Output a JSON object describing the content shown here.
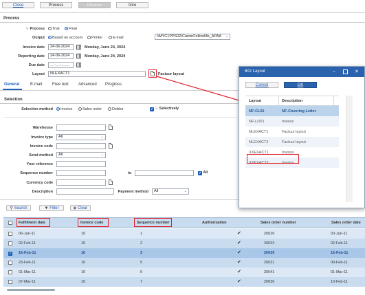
{
  "toolbar": {
    "close": "Close",
    "process": "Process",
    "preview": "Preview",
    "giro": "Giro"
  },
  "process_section": {
    "title": "Process",
    "process_label": "Process",
    "process_options": [
      "Trial",
      "Final"
    ],
    "output_label": "Output",
    "output_options": [
      "Based on account",
      "Printer",
      "E-mail"
    ],
    "printer_value": "\\\\MYC1PPS02\\CanonFollowMe_APAA",
    "invoice_date_label": "Invoice date",
    "invoice_date": "24-06-2024",
    "invoice_date_text": "Monday, June 24, 2024",
    "reporting_date_label": "Reporting date",
    "reporting_date": "24-06-2024",
    "reporting_date_text": "Monday, June 24, 2024",
    "due_date_label": "Due date",
    "due_date": "__-__-____",
    "layout_label": "Layout",
    "layout_value": "NLEXACT1",
    "layout_text": "Factuur layout"
  },
  "tabs": [
    "General",
    "E-mail",
    "Free text",
    "Advanced",
    "Progress"
  ],
  "selection": {
    "title": "Selection",
    "method_label": "Selection method",
    "methods": [
      "Invoice",
      "Sales order",
      "Debtor"
    ],
    "selectively_label": "Selectively",
    "warehouse_label": "Warehouse",
    "invoice_type_label": "Invoice type",
    "invoice_type_value": "All",
    "invoice_code_label": "Invoice code",
    "send_method_label": "Send method",
    "send_method_value": "All",
    "your_reference_label": "Your reference",
    "sequence_number_label": "Sequence number",
    "to_label": "to",
    "all_label": "All",
    "currency_code_label": "Currency code",
    "description_label": "Description",
    "payment_method_label": "Payment method",
    "payment_method_value": "All"
  },
  "filter_bar": {
    "search": "Search",
    "filter": "Filter",
    "clear": "Clear"
  },
  "grid": {
    "headers": [
      "Fulfilment date",
      "Invoice code",
      "Sequence number",
      "Authorization",
      "Sales order number",
      "Sales order date"
    ],
    "rows": [
      {
        "date": "06-Jan-11",
        "code": "10",
        "seq": "1",
        "so": "20026",
        "sodate": "03-Jan-11"
      },
      {
        "date": "02-Feb-11",
        "code": "10",
        "seq": "2",
        "so": "20033",
        "sodate": "02-Feb-11"
      },
      {
        "date": "16-Feb-11",
        "code": "10",
        "seq": "3",
        "so": "20039",
        "sodate": "15-Feb-11"
      },
      {
        "date": "23-Feb-11",
        "code": "10",
        "seq": "5",
        "so": "20031",
        "sodate": "09-Feb-11"
      },
      {
        "date": "01-Mar-11",
        "code": "10",
        "seq": "6",
        "so": "20041",
        "sodate": "01-Mar-11"
      },
      {
        "date": "07-Mar-11",
        "code": "10",
        "seq": "7",
        "so": "20036",
        "sodate": "10-Feb-11"
      }
    ]
  },
  "dialog": {
    "title": "602 Layout",
    "cancel": "Cancel",
    "ok": "OK",
    "headers": [
      "Layout",
      "Description"
    ],
    "rows": [
      {
        "layout": "NF-CL01",
        "desc": "NF-Covering Letter"
      },
      {
        "layout": "NF-LO01",
        "desc": "Invoice"
      },
      {
        "layout": "NLEXACT1",
        "desc": "Factuur layout"
      },
      {
        "layout": "NLEXACT2",
        "desc": "Factuur layout"
      },
      {
        "layout": "XXEXACT1",
        "desc": "Invoice"
      },
      {
        "layout": "XXEXACT2",
        "desc": "Invoice"
      }
    ]
  }
}
